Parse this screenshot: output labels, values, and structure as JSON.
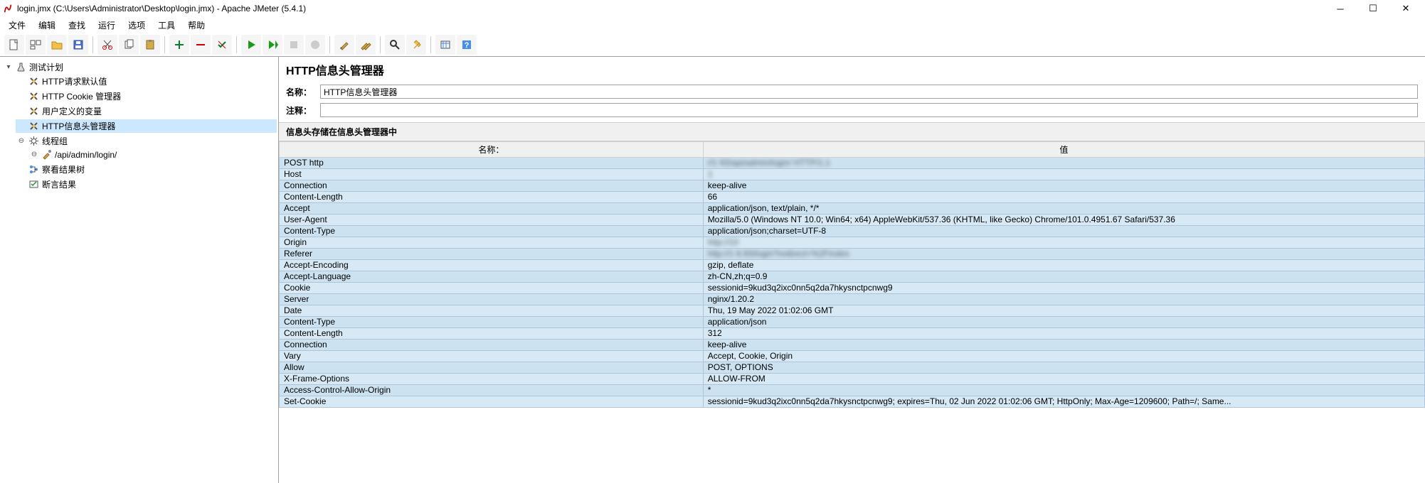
{
  "title": "login.jmx (C:\\Users\\Administrator\\Desktop\\login.jmx) - Apache JMeter (5.4.1)",
  "menu": [
    "文件",
    "编辑",
    "查找",
    "运行",
    "选项",
    "工具",
    "帮助"
  ],
  "toolbar": {
    "timer": ""
  },
  "tree": {
    "root": "测试计划",
    "items": [
      {
        "label": "HTTP请求默认值",
        "icon": "x"
      },
      {
        "label": "HTTP Cookie 管理器",
        "icon": "x"
      },
      {
        "label": "用户定义的变量",
        "icon": "x"
      },
      {
        "label": "HTTP信息头管理器",
        "icon": "x",
        "selected": true
      },
      {
        "label": "线程组",
        "icon": "gear",
        "children": [
          {
            "label": "/api/admin/login/",
            "icon": "pipette"
          }
        ]
      },
      {
        "label": "察看结果树",
        "icon": "tree"
      },
      {
        "label": "断言结果",
        "icon": "assert"
      }
    ]
  },
  "panel": {
    "header": "HTTP信息头管理器",
    "name_label": "名称：",
    "name_value": "HTTP信息头管理器",
    "comment_label": "注释：",
    "comment_value": "",
    "section": "信息头存储在信息头管理器中",
    "col_name": "名称：",
    "col_value": "值",
    "rows": [
      {
        "name": "POST http",
        "value": "//1             93/api/admin/login/ HTTP/1.1",
        "blur": true
      },
      {
        "name": "Host",
        "value": "1                     ",
        "blur": true
      },
      {
        "name": "Connection",
        "value": "keep-alive"
      },
      {
        "name": "Content-Length",
        "value": "66"
      },
      {
        "name": "Accept",
        "value": "application/json, text/plain, */*"
      },
      {
        "name": "User-Agent",
        "value": "Mozilla/5.0 (Windows NT 10.0; Win64; x64) AppleWebKit/537.36 (KHTML, like Gecko) Chrome/101.0.4951.67 Safari/537.36"
      },
      {
        "name": "Content-Type",
        "value": "application/json;charset=UTF-8"
      },
      {
        "name": "Origin",
        "value": "http://10",
        "blur": true
      },
      {
        "name": "Referer",
        "value": "http://1           6.93/login?redirect=%2Findex",
        "blur": true
      },
      {
        "name": "Accept-Encoding",
        "value": "gzip, deflate"
      },
      {
        "name": "Accept-Language",
        "value": "zh-CN,zh;q=0.9"
      },
      {
        "name": "Cookie",
        "value": "sessionid=9kud3q2ixc0nn5q2da7hkysnctpcnwg9"
      },
      {
        "name": "Server",
        "value": "nginx/1.20.2"
      },
      {
        "name": "Date",
        "value": "Thu, 19 May 2022 01:02:06 GMT"
      },
      {
        "name": "Content-Type",
        "value": "application/json"
      },
      {
        "name": "Content-Length",
        "value": "312"
      },
      {
        "name": "Connection",
        "value": "keep-alive"
      },
      {
        "name": "Vary",
        "value": "Accept, Cookie, Origin"
      },
      {
        "name": "Allow",
        "value": "POST, OPTIONS"
      },
      {
        "name": "X-Frame-Options",
        "value": "ALLOW-FROM"
      },
      {
        "name": "Access-Control-Allow-Origin",
        "value": "*"
      },
      {
        "name": "Set-Cookie",
        "value": "sessionid=9kud3q2ixc0nn5q2da7hkysnctpcnwg9; expires=Thu, 02 Jun 2022 01:02:06 GMT; HttpOnly; Max-Age=1209600; Path=/; Same..."
      }
    ]
  }
}
